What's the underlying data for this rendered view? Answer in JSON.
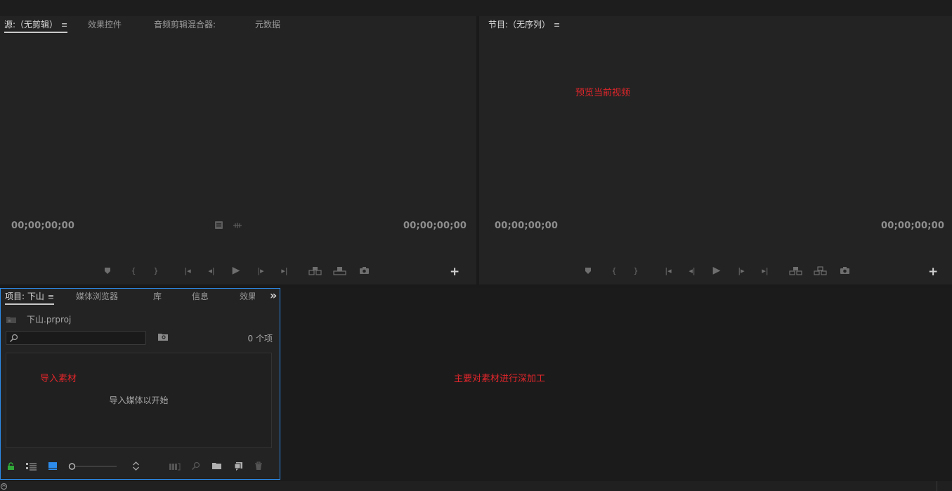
{
  "source_panel": {
    "tabs": [
      {
        "label": "源:（无剪辑）",
        "active": true
      },
      {
        "label": "效果控件",
        "active": false
      },
      {
        "label": "音频剪辑混合器:",
        "active": false
      },
      {
        "label": "元数据",
        "active": false
      }
    ],
    "menu_glyph": "≡",
    "timecode_left": "00;00;00;00",
    "timecode_right": "00;00;00;00"
  },
  "program_panel": {
    "tab_label": "节目:（无序列）",
    "menu_glyph": "≡",
    "annotation": "预览当前视频",
    "timecode_left": "00;00;00;00",
    "timecode_right": "00;00;00;00"
  },
  "project_panel": {
    "tabs": [
      {
        "label": "项目: 下山",
        "active": true
      },
      {
        "label": "媒体浏览器",
        "active": false
      },
      {
        "label": "库",
        "active": false
      },
      {
        "label": "信息",
        "active": false
      },
      {
        "label": "效果",
        "active": false
      }
    ],
    "menu_glyph": "≡",
    "overflow_glyph": "»",
    "project_file": "下山.prproj",
    "item_count": "0 个项",
    "annotation": "导入素材",
    "empty_hint": "导入媒体以开始"
  },
  "timeline_area": {
    "annotation": "主要对素材进行深加工"
  },
  "controls": {
    "plus": "+",
    "marker": "◆",
    "in": "{",
    "out": "}",
    "goto_in": "|◂",
    "step_back": "◂|",
    "play": "▶",
    "step_fwd": "|▸",
    "goto_out": "▸|"
  },
  "colors": {
    "accent_blue": "#2d8ceb",
    "annotation_red": "#e0262b",
    "lock_green": "#2fa838"
  },
  "icons": [
    "search-icon",
    "new-bin-icon",
    "list-view-icon",
    "icon-view-icon",
    "zoom-slider",
    "sort-icon",
    "automate-icon",
    "find-icon",
    "folder-icon",
    "new-item-icon",
    "trash-icon",
    "camera-icon",
    "insert-icon",
    "overwrite-icon",
    "lift-icon",
    "extract-icon",
    "lock-icon"
  ]
}
